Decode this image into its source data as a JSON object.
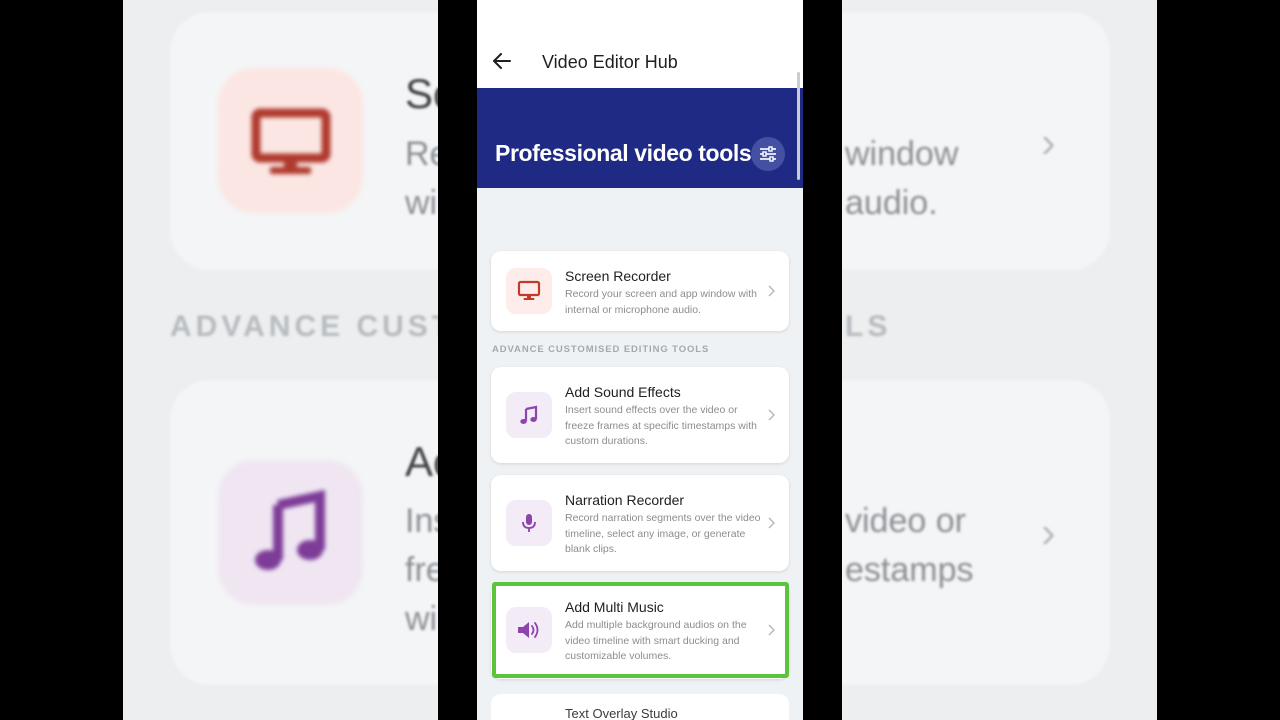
{
  "app": {
    "title": "Video Editor Hub",
    "back_icon": "arrow-left-icon"
  },
  "hero": {
    "title": "Professional video tools",
    "filter_icon": "sliders-icon"
  },
  "section": {
    "heading": "ADVANCE CUSTOMISED EDITING TOOLS"
  },
  "tools": [
    {
      "title": "Screen Recorder",
      "description": "Record your screen and app window with internal or microphone audio.",
      "icon": "monitor-icon",
      "icon_color": "#c0392b",
      "icon_bg": "#fdecea"
    },
    {
      "title": "Add Sound Effects",
      "description": "Insert sound effects over the video or freeze frames at specific timestamps with custom durations.",
      "icon": "music-note-icon",
      "icon_color": "#8e44ad",
      "icon_bg": "#f3ebf6"
    },
    {
      "title": "Narration Recorder",
      "description": "Record narration segments over the video timeline, select any image, or generate blank clips.",
      "icon": "microphone-icon",
      "icon_color": "#8e44ad",
      "icon_bg": "#f3ebf6"
    },
    {
      "title": "Add Multi Music",
      "description": "Add multiple background audios on the video timeline with smart ducking and customizable volumes.",
      "icon": "speaker-icon",
      "icon_color": "#8e44ad",
      "icon_bg": "#f3ebf6"
    },
    {
      "title": "Text Overlay Studio"
    }
  ],
  "colors": {
    "hero_bg": "#1f2a85",
    "highlight": "#5cc43c"
  }
}
